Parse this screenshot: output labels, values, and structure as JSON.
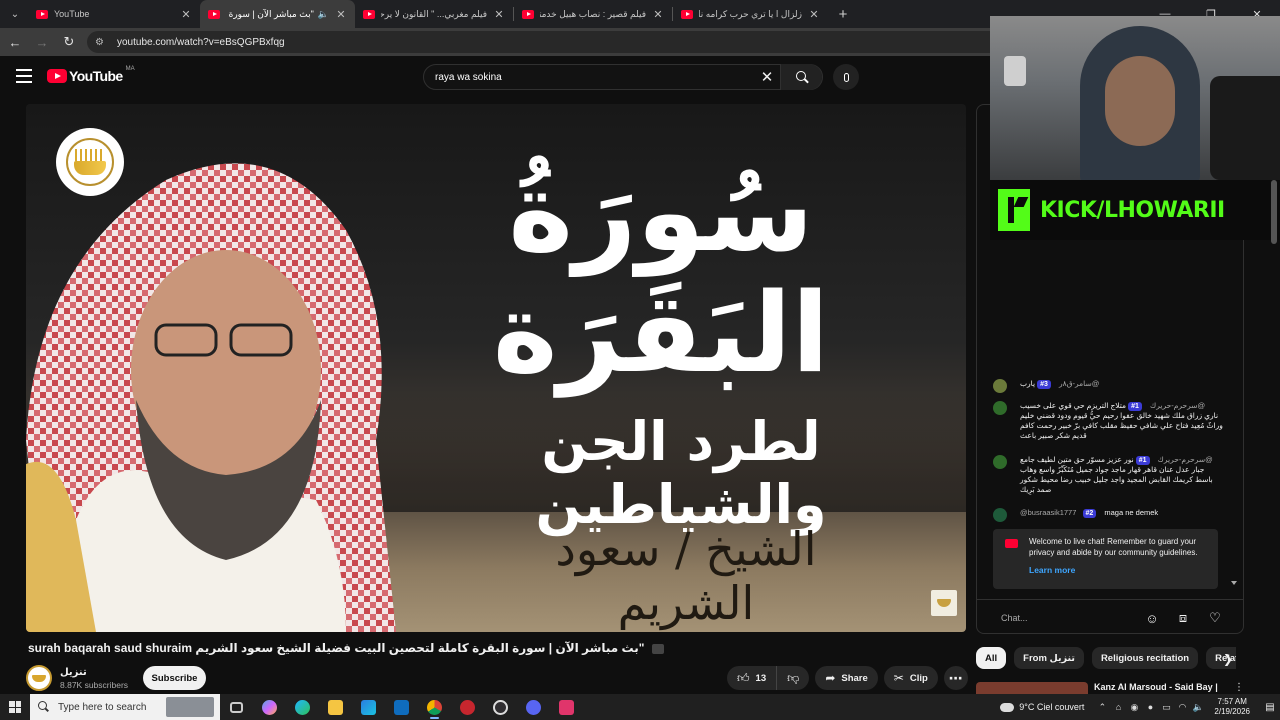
{
  "browser": {
    "tabs": [
      {
        "title": "YouTube",
        "active": false,
        "audio": false
      },
      {
        "title": "\"بث مباشر الآن | سورة ال",
        "active": true,
        "audio": true
      },
      {
        "title": "فيلم مغربي... \" القانون لا يرحم \"",
        "active": false,
        "audio": false
      },
      {
        "title": "فيلم قصير : نصاب هبيل خدمتو ب",
        "active": false,
        "audio": false
      },
      {
        "title": "زلزال ا يا تري حرب كرامه ناوي يح",
        "active": false,
        "audio": false
      }
    ],
    "address": "youtube.com/watch?v=eBsQGPBxfqg"
  },
  "youtube": {
    "logo": "YouTube",
    "country": "MA",
    "search_query": "raya wa sokina"
  },
  "player": {
    "thumbnail_title": "سُورَةُ البَقَرَة",
    "thumbnail_subtitle": "لطرد الجن والشياطين",
    "thumbnail_reciter": "الشيخ / سعود الشريم"
  },
  "video": {
    "title": "\"بث مباشر الآن | سورة البقرة كاملة لتحصين البيت فضيلة الشيخ سعود الشريم surah baqarah saud shuraim",
    "channel_name": "تنزيل",
    "subscribers": "8.87K subscribers",
    "subscribe_label": "Subscribe",
    "likes": "13",
    "share_label": "Share",
    "clip_label": "Clip"
  },
  "chat": {
    "messages": [
      {
        "author": "@سامر-ق٨ر",
        "badge": "#3",
        "text": "يارب",
        "avatar_color": "#6b7a3a"
      },
      {
        "author": "@سرحرم-حريرك",
        "badge": "#1",
        "text": "متلاج التريزم حي قوي على خسيب ناري زراق ملك شهيد خالق عفوا رحيم حيُّ قيوم ودود قضني خليم وراثٌ مُعِيد فتاح علي شافي حفيظ مقلب كافي برّ خبير رحمت كافم قديم شكر صبير باعث",
        "avatar_color": "#2f6b2a"
      },
      {
        "author": "@سرحرم-حريرك",
        "badge": "#1",
        "text": "نور عزيز مسوّر حق متين لطيف جامع جبار عدل عنان قاهر قهار ماجد جواد جميل مُتَكَبِّرٌ واسع وهاب باسط كريمك القابض المجيد واجد جليل خبيب رضا محيط شكور صمد بَرِيك",
        "avatar_color": "#2f6b2a"
      },
      {
        "author": "@busraasik1777",
        "badge": "#2",
        "text": "maga ne demek",
        "avatar_color": "#1e5a3a"
      }
    ],
    "notice": "Welcome to live chat! Remember to guard your privacy and abide by our community guidelines.",
    "learn_more": "Learn more",
    "input_placeholder": "Chat..."
  },
  "overlay": {
    "kick_text": "KICK/LHOWARII"
  },
  "chips": [
    {
      "label": "All",
      "active": true
    },
    {
      "label": "From تنزيل",
      "active": false
    },
    {
      "label": "Religious recitation",
      "active": false
    },
    {
      "label": "Relate",
      "active": false
    }
  ],
  "recommendation": {
    "title": "Kanz Al Marsoud - Said Bay |"
  },
  "taskbar": {
    "search_placeholder": "Type here to search",
    "weather": "9°C  Ciel couvert",
    "time": "7:57 AM",
    "date": "2/19/2026"
  },
  "colors": {
    "youtube_red": "#ff0033",
    "kick_green": "#53fc18",
    "link_blue": "#3ea6ff",
    "member_badge": "#3b3bd6"
  }
}
